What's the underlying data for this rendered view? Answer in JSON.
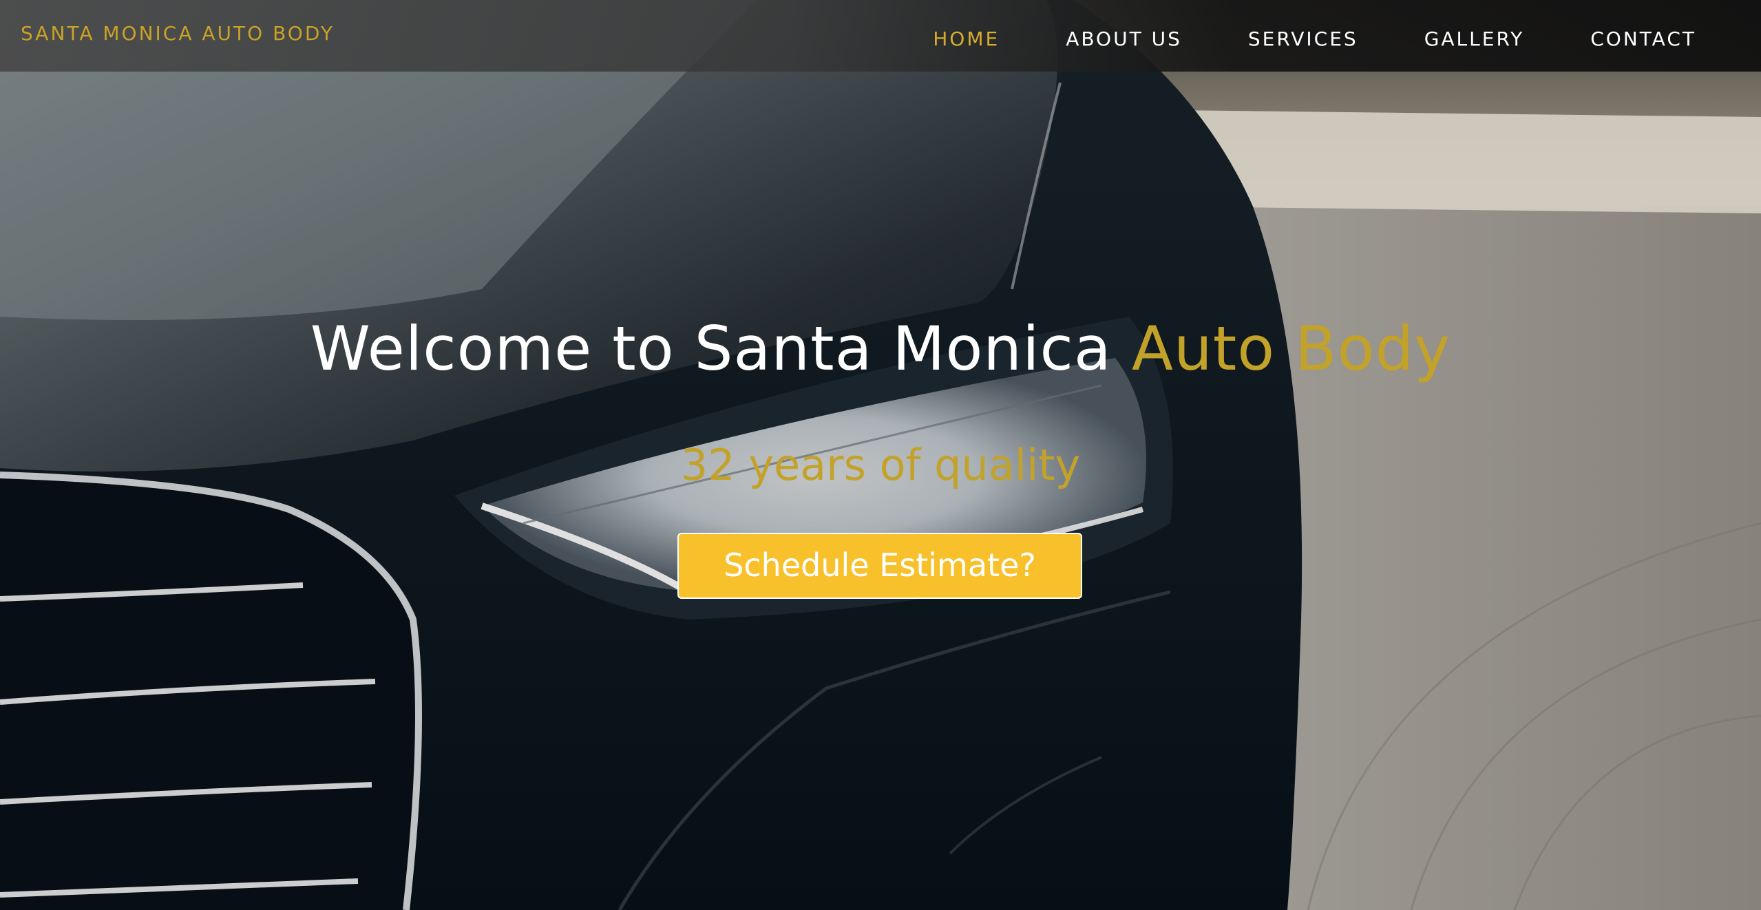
{
  "header": {
    "brand": "SANTA MONICA AUTO BODY",
    "nav": [
      {
        "label": "HOME",
        "active": true
      },
      {
        "label": "ABOUT US",
        "active": false
      },
      {
        "label": "SERVICES",
        "active": false
      },
      {
        "label": "GALLERY",
        "active": false
      },
      {
        "label": "CONTACT",
        "active": false
      }
    ]
  },
  "hero": {
    "title_main": "Welcome to Santa Monica ",
    "title_accent": "Auto Body",
    "subtitle": "32 years of quality",
    "cta_label": "Schedule Estimate?",
    "background": "dark-car-headlight-photo"
  },
  "colors": {
    "accent_gold": "#c3a22a",
    "button_yellow": "#f8c12c",
    "text_white": "#ffffff",
    "dark_navy": "#0b1620"
  }
}
